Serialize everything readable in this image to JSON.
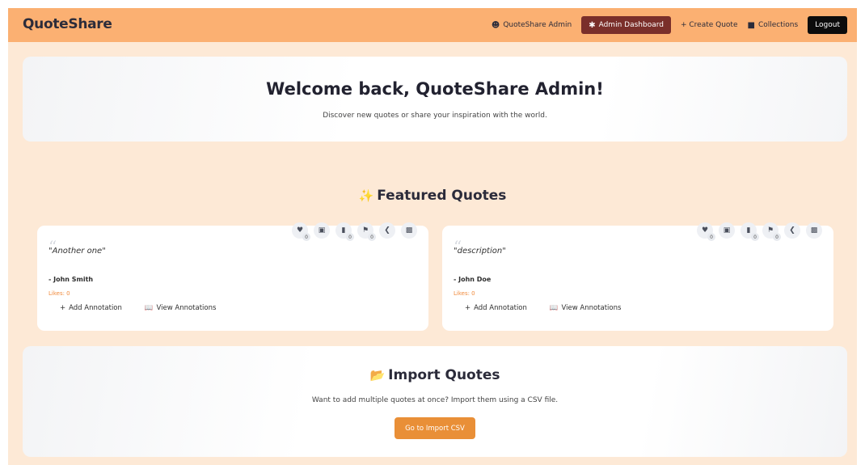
{
  "navbar": {
    "brand": "QuoteShare",
    "admin_link": "QuoteShare Admin",
    "dashboard_button": "Admin Dashboard",
    "create_quote": "+ Create Quote",
    "collections": "Collections",
    "logout": "Logout"
  },
  "welcome": {
    "heading": "Welcome back, QuoteShare Admin!",
    "subtext": "Discover new quotes or share your inspiration with the world."
  },
  "featured": {
    "heading": "Featured Quotes",
    "quotes": [
      {
        "text": "\"Another one\"",
        "author": "- John Smith",
        "likes": "Likes: 0",
        "like_count": "0",
        "bookmark_count": "0",
        "flag_count": "0",
        "add_annotation": "Add Annotation",
        "view_annotations": "View Annotations"
      },
      {
        "text": "\"description\"",
        "author": "- John Doe",
        "likes": "Likes: 0",
        "like_count": "0",
        "bookmark_count": "0",
        "flag_count": "0",
        "add_annotation": "Add Annotation",
        "view_annotations": "View Annotations"
      }
    ]
  },
  "import": {
    "heading": "Import Quotes",
    "subtext": "Want to add multiple quotes at once? Import them using a CSV file.",
    "button": "Go to Import CSV"
  },
  "colors": {
    "navbar": "#fbb072",
    "background": "#fde9d6",
    "dashboard_button": "#7a2f2a",
    "import_button": "#e98f37",
    "likes_text": "#f08a3c"
  }
}
